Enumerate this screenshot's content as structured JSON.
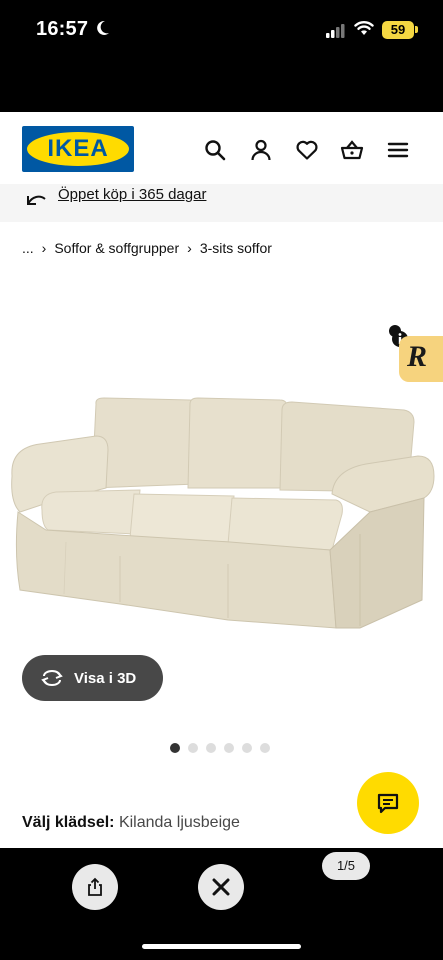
{
  "status": {
    "time": "16:57",
    "battery": "59"
  },
  "header": {
    "logo_text": "IKEA"
  },
  "promo": {
    "link_text": "Öppet köp i 365 dagar"
  },
  "breadcrumb": {
    "ellipsis": "...",
    "items": [
      "Soffor & soffgrupper",
      "3-sits soffor"
    ]
  },
  "badge": {
    "letter": "R"
  },
  "view3d": {
    "label": "Visa i 3D"
  },
  "carousel": {
    "total_dots": 6,
    "active_index": 0
  },
  "fabric": {
    "label": "Välj klädsel:",
    "value": "Kilanda ljusbeige"
  },
  "viewer": {
    "pager": "1/5"
  },
  "colors": {
    "ikea_blue": "#0058a3",
    "ikea_yellow": "#ffdb00",
    "sofa_beige": "#e8e1cf"
  }
}
